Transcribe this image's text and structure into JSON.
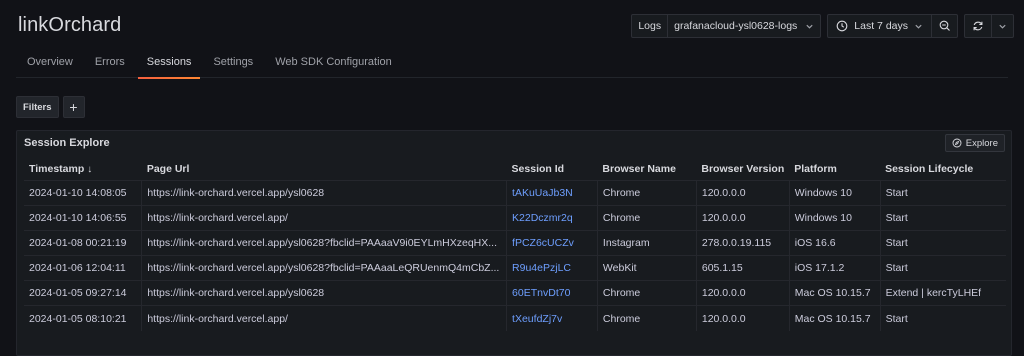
{
  "app": {
    "title": "linkOrchard"
  },
  "toolbar": {
    "datasource_label": "Logs",
    "datasource_value": "grafanacloud-ysl0628-logs",
    "time_range": "Last 7 days"
  },
  "tabs": [
    {
      "label": "Overview",
      "active": false
    },
    {
      "label": "Errors",
      "active": false
    },
    {
      "label": "Sessions",
      "active": true
    },
    {
      "label": "Settings",
      "active": false
    },
    {
      "label": "Web SDK Configuration",
      "active": false
    }
  ],
  "filters": {
    "label": "Filters",
    "add": "+"
  },
  "panel": {
    "title": "Session Explore",
    "explore_label": "Explore",
    "columns": [
      "Timestamp",
      "Page Url",
      "Session Id",
      "Browser Name",
      "Browser Version",
      "Platform",
      "Session Lifecycle"
    ],
    "rows": [
      [
        "2024-01-10 14:08:05",
        "https://link-orchard.vercel.app/ysl0628",
        "tAKuUaJb3N",
        "Chrome",
        "120.0.0.0",
        "Windows 10",
        "Start"
      ],
      [
        "2024-01-10 14:06:55",
        "https://link-orchard.vercel.app/",
        "K22Dczmr2q",
        "Chrome",
        "120.0.0.0",
        "Windows 10",
        "Start"
      ],
      [
        "2024-01-08 00:21:19",
        "https://link-orchard.vercel.app/ysl0628?fbclid=PAAaaV9i0EYLmHXzeqHX...",
        "fPCZ6cUCZv",
        "Instagram",
        "278.0.0.19.115",
        "iOS 16.6",
        "Start"
      ],
      [
        "2024-01-06 12:04:11",
        "https://link-orchard.vercel.app/ysl0628?fbclid=PAAaaLeQRUenmQ4mCbZ...",
        "R9u4ePzjLC",
        "WebKit",
        "605.1.15",
        "iOS 17.1.2",
        "Start"
      ],
      [
        "2024-01-05 09:27:14",
        "https://link-orchard.vercel.app/ysl0628",
        "60ETnvDt70",
        "Chrome",
        "120.0.0.0",
        "Mac OS 10.15.7",
        "Extend | kercTyLHEf"
      ],
      [
        "2024-01-05 08:10:21",
        "https://link-orchard.vercel.app/",
        "tXeufdZj7v",
        "Chrome",
        "120.0.0.0",
        "Mac OS 10.15.7",
        "Start"
      ]
    ]
  },
  "colors": {
    "accent_tab": "#f55f3e",
    "link": "#6e9fff",
    "background": "#111217",
    "panel": "#181b1f"
  },
  "icons": [
    "chevron-down-icon",
    "clock-icon",
    "zoom-out-icon",
    "refresh-icon",
    "compass-icon",
    "sort-down-icon"
  ]
}
